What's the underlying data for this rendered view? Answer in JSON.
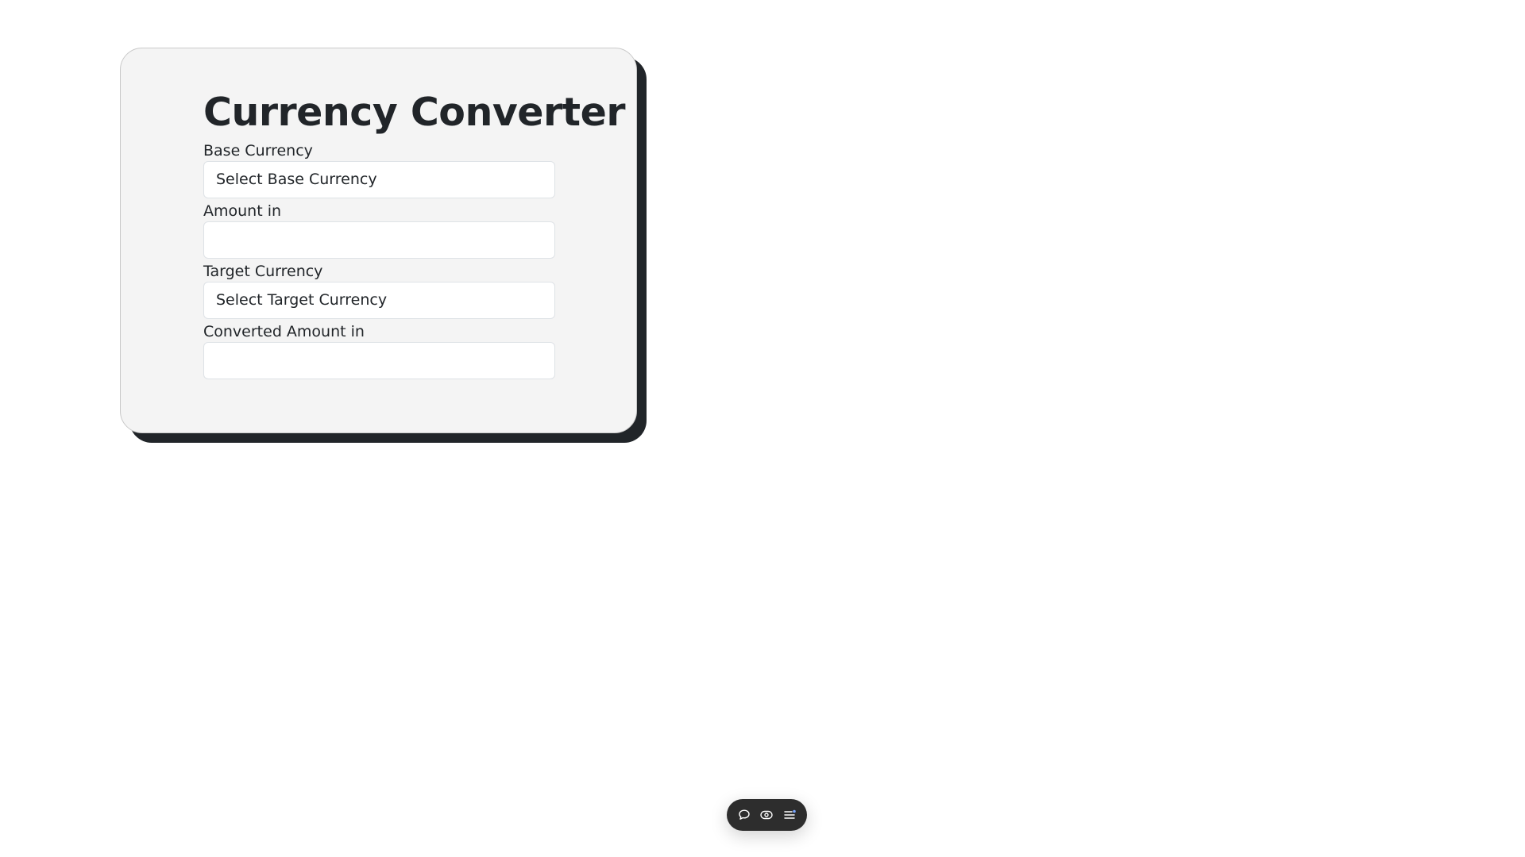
{
  "converter": {
    "title": "Currency Converter",
    "base_currency_label": "Base Currency",
    "base_currency_selected": "Select Base Currency",
    "amount_label": "Amount in",
    "amount_value": "",
    "target_currency_label": "Target Currency",
    "target_currency_selected": "Select Target Currency",
    "converted_label": "Converted Amount in",
    "converted_value": ""
  },
  "dock": {
    "items": [
      {
        "icon": "chat-bubble-icon"
      },
      {
        "icon": "eye-icon"
      },
      {
        "icon": "menu-list-icon"
      }
    ]
  },
  "colors": {
    "card_background": "#f4f4f4",
    "card_shadow": "#212529",
    "text": "#212529",
    "dock_background": "#2d2d2d"
  }
}
